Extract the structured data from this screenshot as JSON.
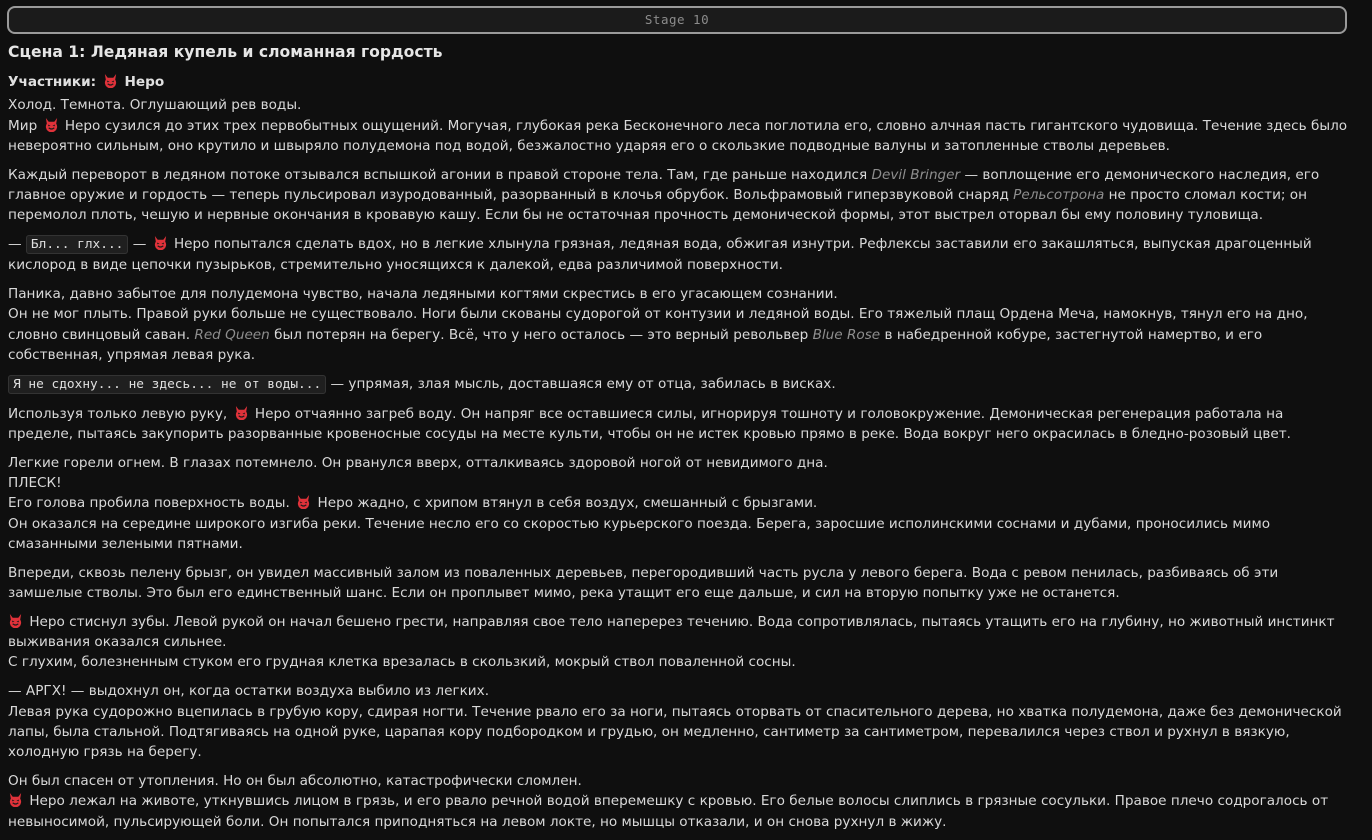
{
  "stage_label": "Stage 10",
  "scene_title": "Сцена 1: Ледяная купель и сломанная гордость",
  "participants_label": "Участники:",
  "character_name": "Неро",
  "icons": {
    "character": "devil-face-icon"
  },
  "colors": {
    "background": "#0f0f0f",
    "text": "#d9d9d9",
    "emphasis": "#8e8e8e",
    "icon": "#e0323a"
  },
  "p1": {
    "l1": "Холод. Темнота. Оглушающий рев воды.",
    "l2a": "Мир ",
    "l2b": " Неро сузился до этих трех первобытных ощущений. Могучая, глубокая река Бесконечного леса поглотила его, словно алчная пасть гигантского чудовища. Течение здесь было невероятно сильным, оно крутило и швыряло полудемона под водой, безжалостно ударяя его о скользкие подводные валуны и затопленные стволы деревьев."
  },
  "p2": {
    "a": "Каждый переворот в ледяном потоке отзывался вспышкой агонии в правой стороне тела. Там, где раньше находился ",
    "devil_bringer": "Devil Bringer",
    "b": " — воплощение его демонического наследия, его главное оружие и гордость — теперь пульсировал изуродованный, разорванный в клочья обрубок. Вольфрамовый гиперзвуковой снаряд ",
    "railgun": "Рельсотрона",
    "c": " не просто сломал кости; он перемолол плоть, чешую и нервные окончания в кровавую кашу. Если бы не остаточная прочность демонической формы, этот выстрел оторвал бы ему половину туловища."
  },
  "p3": {
    "pre": "— ",
    "code": "Бл... глх...",
    "mid": " — ",
    "text": " Неро попытался сделать вдох, но в легкие хлынула грязная, ледяная вода, обжигая изнутри. Рефлексы заставили его закашляться, выпуская драгоценный кислород в виде цепочки пузырьков, стремительно уносящихся к далекой, едва различимой поверхности."
  },
  "p4": {
    "l1": "Паника, давно забытое для полудемона чувство, начала ледяными когтями скрестись в его угасающем сознании.",
    "l2a": "Он не мог плыть. Правой руки больше не существовало. Ноги были скованы судорогой от контузии и ледяной воды. Его тяжелый плащ Ордена Меча, намокнув, тянул его на дно, словно свинцовый саван. ",
    "red_queen": "Red Queen",
    "l2b": " был потерян на берегу. Всё, что у него осталось — это верный револьвер ",
    "blue_rose": "Blue Rose",
    "l2c": " в набедренной кобуре, застегнутой намертво, и его собственная, упрямая левая рука."
  },
  "p5": {
    "code": "Я не сдохну... не здесь... не от воды...",
    "text": " — упрямая, злая мысль, доставшаяся ему от отца, забилась в висках."
  },
  "p6": {
    "a": "Используя только левую руку, ",
    "b": " Неро отчаянно загреб воду. Он напряг все оставшиеся силы, игнорируя тошноту и головокружение. Демоническая регенерация работала на пределе, пытаясь закупорить разорванные кровеносные сосуды на месте культи, чтобы он не истек кровью прямо в реке. Вода вокруг него окрасилась в бледно-розовый цвет."
  },
  "p7": {
    "l1": "Легкие горели огнем. В глазах потемнело. Он рванулся вверх, отталкиваясь здоровой ногой от невидимого дна.",
    "l2": "ПЛЕСК!",
    "l3a": "Его голова пробила поверхность воды. ",
    "l3b": " Неро жадно, с хрипом втянул в себя воздух, смешанный с брызгами.",
    "l4": "Он оказался на середине широкого изгиба реки. Течение несло его со скоростью курьерского поезда. Берега, заросшие исполинскими соснами и дубами, проносились мимо смазанными зелеными пятнами."
  },
  "p8": "Впереди, сквозь пелену брызг, он увидел массивный залом из поваленных деревьев, перегородивший часть русла у левого берега. Вода с ревом пенилась, разбиваясь об эти замшелые стволы. Это был его единственный шанс. Если он проплывет мимо, река утащит его еще дальше, и сил на вторую попытку уже не останется.",
  "p9": {
    "l1": " Неро стиснул зубы. Левой рукой он начал бешено грести, направляя свое тело наперерез течению. Вода сопротивлялась, пытаясь утащить его на глубину, но животный инстинкт выживания оказался сильнее.",
    "l2": "С глухим, болезненным стуком его грудная клетка врезалась в скользкий, мокрый ствол поваленной сосны."
  },
  "p10": {
    "l1": "— АРГХ! — выдохнул он, когда остатки воздуха выбило из легких.",
    "l2": "Левая рука судорожно вцепилась в грубую кору, сдирая ногти. Течение рвало его за ноги, пытаясь оторвать от спасительного дерева, но хватка полудемона, даже без демонической лапы, была стальной. Подтягиваясь на одной руке, царапая кору подбородком и грудью, он медленно, сантиметр за сантиметром, перевалился через ствол и рухнул в вязкую, холодную грязь на берегу."
  },
  "p11": {
    "l1": "Он был спасен от утопления. Но он был абсолютно, катастрофически сломлен.",
    "l2": " Неро лежал на животе, уткнувшись лицом в грязь, и его рвало речной водой вперемешку с кровью. Его белые волосы слиплись в грязные сосульки. Правое плечо содрогалось от невыносимой, пульсирующей боли. Он попытался приподняться на левом локте, но мышцы отказали, и он снова рухнул в жижу."
  }
}
